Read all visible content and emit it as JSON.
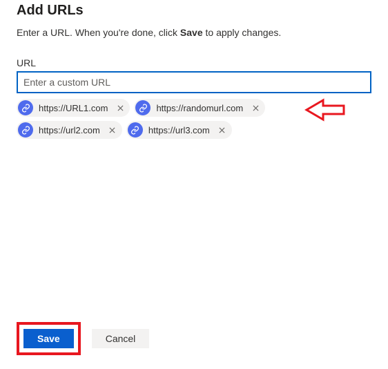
{
  "header": {
    "title": "Add URLs",
    "subtitle_pre": "Enter a URL. When you're done, click ",
    "subtitle_bold": "Save",
    "subtitle_post": " to apply changes."
  },
  "field": {
    "label": "URL",
    "placeholder": "Enter a custom URL",
    "value": ""
  },
  "chips": [
    {
      "label": "https://URL1.com"
    },
    {
      "label": "https://randomurl.com"
    },
    {
      "label": "https://url2.com"
    },
    {
      "label": "https://url3.com"
    }
  ],
  "footer": {
    "save_label": "Save",
    "cancel_label": "Cancel"
  },
  "colors": {
    "accent": "#0a5fce",
    "chip_badge": "#4f6bed",
    "annotation": "#e8171f"
  }
}
